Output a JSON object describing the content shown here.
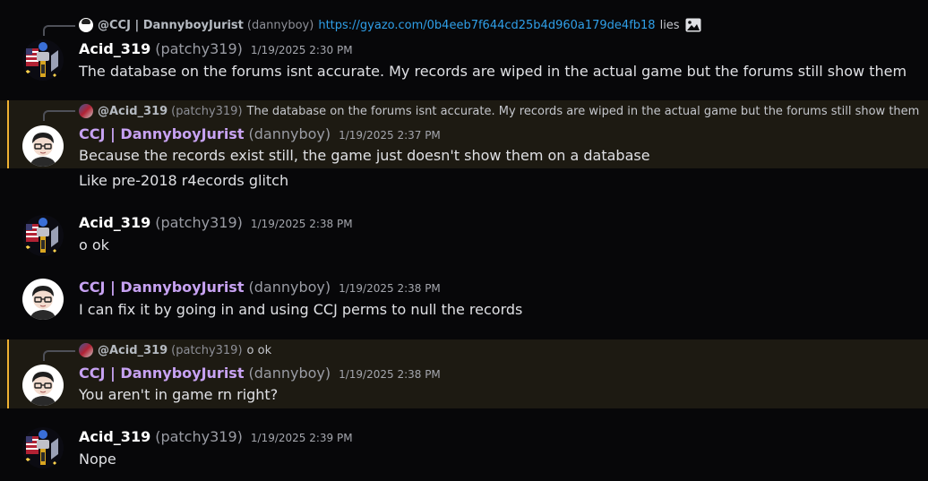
{
  "messages": [
    {
      "reply": {
        "name": "@CCJ | DannyboyJurist",
        "username": "(dannyboy)",
        "link": "https://gyazo.com/0b4eeb7f644cd25b4d960a179de4fb18",
        "text": "lies"
      },
      "author": "Acid_319",
      "username": "(patchy319)",
      "time": "1/19/2025 2:30 PM",
      "lines": [
        "The database on the forums isnt accurate. My records are wiped in the actual game but the forums still show them"
      ]
    },
    {
      "reply": {
        "name": "@Acid_319",
        "username": "(patchy319)",
        "text": "The database on the forums isnt accurate. My records are wiped in the actual game but the forums still show them"
      },
      "author": "CCJ | DannyboyJurist",
      "username": "(dannyboy)",
      "time": "1/19/2025 2:37 PM",
      "lines": [
        "Because the records exist still, the game just doesn't show them on a database",
        "Like pre-2018 r4ecords glitch"
      ]
    },
    {
      "author": "Acid_319",
      "username": "(patchy319)",
      "time": "1/19/2025 2:38 PM",
      "lines": [
        "o ok"
      ]
    },
    {
      "author": "CCJ | DannyboyJurist",
      "username": "(dannyboy)",
      "time": "1/19/2025 2:38 PM",
      "lines": [
        "I can fix it by going in and using CCJ perms to null the records"
      ]
    },
    {
      "reply": {
        "name": "@Acid_319",
        "username": "(patchy319)",
        "text": "o ok"
      },
      "author": "CCJ | DannyboyJurist",
      "username": "(dannyboy)",
      "time": "1/19/2025 2:38 PM",
      "lines": [
        "You aren't in game rn right?"
      ]
    },
    {
      "author": "Acid_319",
      "username": "(patchy319)",
      "time": "1/19/2025 2:39 PM",
      "lines": [
        "Nope"
      ]
    }
  ],
  "icons": {
    "image_attachment": "image-icon",
    "avatar_acid": "flag-crest-avatar",
    "avatar_danny": "glasses-boy-avatar"
  },
  "colors": {
    "mention_bar": "#f0b232",
    "danny_name": "#c7a2f2",
    "link": "#2f9fe8"
  }
}
